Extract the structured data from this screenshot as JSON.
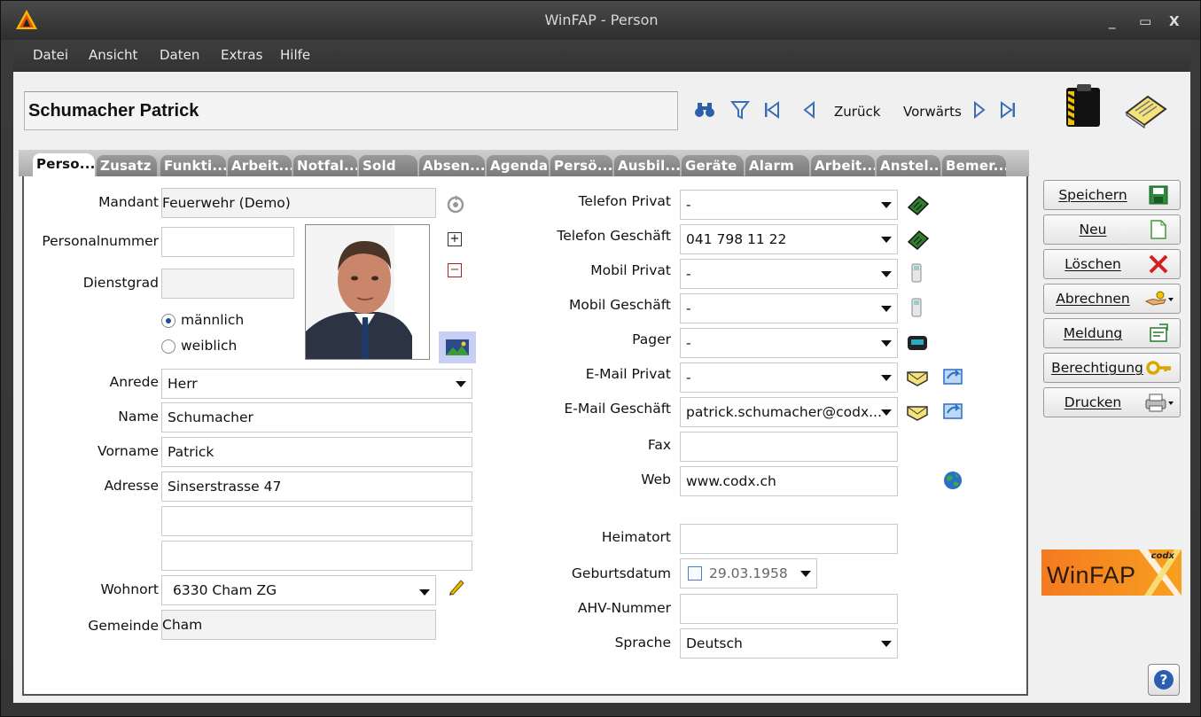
{
  "window": {
    "title": "WinFAP - Person",
    "minimize": "_",
    "maximize": "▭",
    "close": "X"
  },
  "menu": [
    "Datei",
    "Ansicht",
    "Daten",
    "Extras",
    "Hilfe"
  ],
  "header": {
    "record_name": "Schumacher Patrick",
    "back_label": "Zurück",
    "forward_label": "Vorwärts"
  },
  "tabs": [
    "Perso...",
    "Zusatz",
    "Funkti...",
    "Arbeit...",
    "Notfal...",
    "Sold",
    "Absen...",
    "Agenda",
    "Persö...",
    "Ausbil...",
    "Geräte",
    "Alarm",
    "Arbeit...",
    "Anstel...",
    "Bemer..."
  ],
  "left": {
    "mandant_label": "Mandant",
    "mandant_value": "Feuerwehr (Demo)",
    "personalnummer_label": "Personalnummer",
    "personalnummer_value": "",
    "dienstgrad_label": "Dienstgrad",
    "dienstgrad_value": "",
    "male_label": "männlich",
    "female_label": "weiblich",
    "anrede_label": "Anrede",
    "anrede_value": "Herr",
    "name_label": "Name",
    "name_value": "Schumacher",
    "vorname_label": "Vorname",
    "vorname_value": "Patrick",
    "adresse_label": "Adresse",
    "adresse1_value": "Sinserstrasse 47",
    "adresse2_value": "",
    "adresse3_value": "",
    "wohnort_label": "Wohnort",
    "wohnort_value": "6330 Cham ZG",
    "gemeinde_label": "Gemeinde",
    "gemeinde_value": "Cham"
  },
  "right_fields": {
    "tel_privat_label": "Telefon Privat",
    "tel_privat_value": "-",
    "tel_geschaeft_label": "Telefon Geschäft",
    "tel_geschaeft_value": "041 798 11 22",
    "mobil_privat_label": "Mobil Privat",
    "mobil_privat_value": "-",
    "mobil_geschaeft_label": "Mobil Geschäft",
    "mobil_geschaeft_value": "-",
    "pager_label": "Pager",
    "pager_value": "-",
    "email_privat_label": "E-Mail Privat",
    "email_privat_value": "-",
    "email_geschaeft_label": "E-Mail Geschäft",
    "email_geschaeft_value": "patrick.schumacher@codx...",
    "fax_label": "Fax",
    "fax_value": "",
    "web_label": "Web",
    "web_value": "www.codx.ch",
    "heimatort_label": "Heimatort",
    "heimatort_value": "",
    "geburtsdatum_label": "Geburtsdatum",
    "geburtsdatum_value": "29.03.1958",
    "ahv_label": "AHV-Nummer",
    "ahv_value": "",
    "sprache_label": "Sprache",
    "sprache_value": "Deutsch"
  },
  "actions": [
    "Speichern",
    "Neu",
    "Löschen",
    "Abrechnen",
    "Meldung",
    "Berechtigung",
    "Drucken"
  ],
  "logo": {
    "text": "WinFAP",
    "small": "codx"
  },
  "colors": {
    "accent": "#f47a20",
    "link_blue": "#3a6fb8",
    "delete_red": "#d32020",
    "save_green": "#2e8b3d"
  }
}
